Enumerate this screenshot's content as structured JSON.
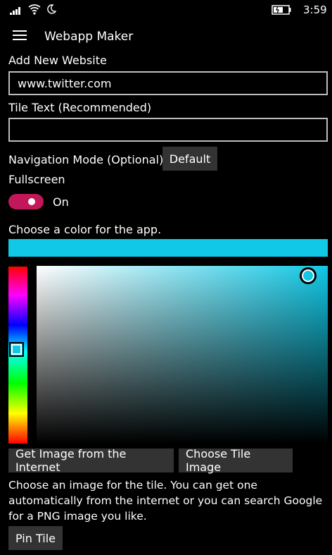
{
  "status_bar": {
    "time": "3:59",
    "icons": [
      "signal-icon",
      "wifi-icon",
      "quiet-hours-moon-icon",
      "battery-icon"
    ]
  },
  "app_bar": {
    "title": "Webapp Maker",
    "menu_icon": "hamburger-icon"
  },
  "form": {
    "add_website_label": "Add New Website",
    "website_value": "www.twitter.com",
    "tile_text_label": "Tile Text (Recommended)",
    "tile_text_value": "",
    "nav_mode_label": "Navigation Mode (Optional)",
    "nav_mode_button": "Default",
    "fullscreen_label": "Fullscreen",
    "fullscreen_state": "On",
    "color_label": "Choose a color for the app.",
    "get_image_button": "Get Image from the Internet",
    "choose_tile_button": "Choose Tile Image",
    "tile_description": "Choose an image for the tile. You can get one automatically from the internet or you can search Google for a PNG image you like.",
    "pin_tile_button": "Pin Tile"
  },
  "colors": {
    "selected": "#11c8e6",
    "toggle_on": "#c2185b",
    "button_bg": "#333333",
    "background": "#000000"
  }
}
